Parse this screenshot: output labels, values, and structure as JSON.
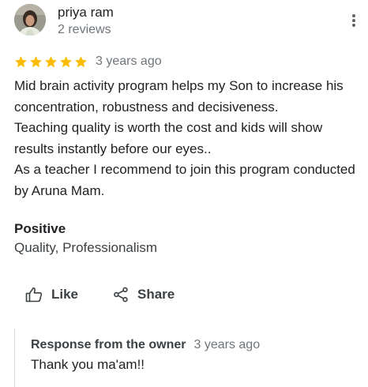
{
  "reviewer": {
    "name": "priya ram",
    "meta": "2 reviews"
  },
  "review": {
    "rating": 5,
    "max_rating": 5,
    "time": "3 years ago",
    "text": "Mid brain activity program helps my Son to increase his concentration, robustness and decisiveness.\nTeaching quality is worth the cost and kids will show results instantly before our eyes..\nAs a teacher I recommend to join this program conducted by Aruna Mam."
  },
  "aspects": {
    "title": "Positive",
    "values": "Quality, Professionalism"
  },
  "actions": {
    "like_label": "Like",
    "share_label": "Share"
  },
  "owner_response": {
    "title": "Response from the owner",
    "time": "3 years ago",
    "text": "Thank you ma'am!!"
  },
  "colors": {
    "star": "#fbbc04",
    "text": "#202124",
    "secondary_text": "#70757a",
    "divider": "#dadce0"
  },
  "icons": {
    "more": "more-vertical-icon",
    "like": "thumb-up-icon",
    "share": "share-icon",
    "star": "star-icon"
  }
}
